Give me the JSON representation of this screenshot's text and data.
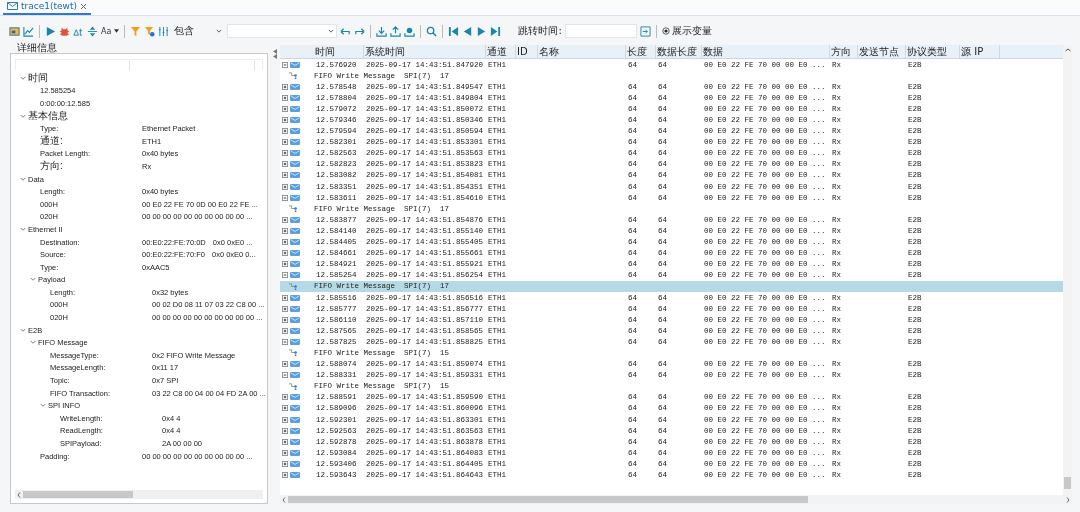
{
  "tab": {
    "label": "trace1(tewt)",
    "selected": true
  },
  "toolbar": {
    "font_label": "Aa",
    "filter_mode": "包含",
    "jump_label": "跳转时间:",
    "show_vars": {
      "label": "展示变量",
      "selected": true
    }
  },
  "detail": {
    "title": "详细信息",
    "tree": [
      {
        "label": "时间",
        "expanded": true,
        "children": [
          {
            "label": "12.585254"
          },
          {
            "label": "0:00:00:12.585"
          }
        ]
      },
      {
        "label": "基本信息",
        "expanded": true,
        "children": [
          {
            "label": "Type:",
            "value": "Ethernet Packet"
          },
          {
            "label": "通道:",
            "value": "ETH1"
          },
          {
            "label": "Packet Length:",
            "value": "0x40 bytes"
          },
          {
            "label": "方向:",
            "value": "Rx"
          }
        ]
      },
      {
        "label": "Data",
        "expanded": true,
        "children": [
          {
            "label": "Length:",
            "value": "0x40 bytes"
          },
          {
            "label": "000H",
            "value": "00 E0 22 FE 70 0D 00 E0 22 FE ..."
          },
          {
            "label": "020H",
            "value": "00 00 00 00 00 00 00 00 00 00 ..."
          }
        ]
      },
      {
        "label": "Ethernet II",
        "expanded": true,
        "children": [
          {
            "label": "Destination:",
            "value": "00:E0:22:FE:70:0D",
            "value2": "0x0 0xE0 ..."
          },
          {
            "label": "Source:",
            "value": "00:E0:22:FE:70:F0",
            "value2": "0x0 0xE0 0..."
          },
          {
            "label": "Type:",
            "value": "0xAAC5"
          },
          {
            "label": "Payload",
            "expanded": true,
            "children": [
              {
                "label": "Length:",
                "value": "0x32 bytes"
              },
              {
                "label": "000H",
                "value": "00 02 D0 08 11 07 03 22 C8 00 ..."
              },
              {
                "label": "020H",
                "value": "00 00 00 00 00 00 00 00 00 00 ..."
              }
            ]
          }
        ]
      },
      {
        "label": "E2B",
        "expanded": true,
        "children": [
          {
            "label": "FIFO Message",
            "expanded": true,
            "children": [
              {
                "label": "MessageType:",
                "value": "0x2 FIFO Write Message"
              },
              {
                "label": "MessageLength:",
                "value": "0x11 17"
              },
              {
                "label": "Topic:",
                "value": "0x7 SPI"
              },
              {
                "label": "FIFO Transaction:",
                "value": "03 22 C8 00 04 00 04 FD 2A 00 ..."
              },
              {
                "label": "SPI INFO",
                "expanded": true,
                "children": [
                  {
                    "label": "WriteLength:",
                    "value": "0x4 4"
                  },
                  {
                    "label": "ReadLength:",
                    "value": "0x4 4"
                  },
                  {
                    "label": "SPIPayload:",
                    "value": "2A 00 00 00"
                  }
                ]
              }
            ]
          },
          {
            "label": "Padding:",
            "value": "00 00 00 00 00 00 00 00 00 00 ..."
          }
        ]
      }
    ]
  },
  "table": {
    "columns": [
      "时间",
      "系统时间",
      "通道",
      "ID",
      "名称",
      "长度",
      "数据长度",
      "数据",
      "方向",
      "发送节点",
      "协议类型",
      "源 IP"
    ],
    "rows": [
      {
        "kind": "packet",
        "expanded": true,
        "selected": false,
        "time": "12.576920",
        "sys_time": "2025-09-17 14:43:51.847920",
        "channel": "ETH1",
        "length": "64",
        "data_length": "64",
        "data": "00 E0 22 FE 70 00 00 E0 ...",
        "direction": "Rx",
        "protocol": "E2B"
      },
      {
        "kind": "message",
        "selected": false,
        "text": "FIFO Write Message  SPI(7)  17"
      },
      {
        "kind": "packet",
        "expanded": false,
        "selected": false,
        "time": "12.578548",
        "sys_time": "2025-09-17 14:43:51.849547",
        "channel": "ETH1",
        "length": "64",
        "data_length": "64",
        "data": "00 E0 22 FE 70 00 00 E0 ...",
        "direction": "Rx",
        "protocol": "E2B"
      },
      {
        "kind": "packet",
        "expanded": false,
        "selected": false,
        "time": "12.578804",
        "sys_time": "2025-09-17 14:43:51.849804",
        "channel": "ETH1",
        "length": "64",
        "data_length": "64",
        "data": "00 E0 22 FE 70 00 00 E0 ...",
        "direction": "Rx",
        "protocol": "E2B"
      },
      {
        "kind": "packet",
        "expanded": false,
        "selected": false,
        "time": "12.579072",
        "sys_time": "2025-09-17 14:43:51.850072",
        "channel": "ETH1",
        "length": "64",
        "data_length": "64",
        "data": "00 E0 22 FE 70 00 00 E0 ...",
        "direction": "Rx",
        "protocol": "E2B"
      },
      {
        "kind": "packet",
        "expanded": false,
        "selected": false,
        "time": "12.579346",
        "sys_time": "2025-09-17 14:43:51.850346",
        "channel": "ETH1",
        "length": "64",
        "data_length": "64",
        "data": "00 E0 22 FE 70 00 00 E0 ...",
        "direction": "Rx",
        "protocol": "E2B"
      },
      {
        "kind": "packet",
        "expanded": false,
        "selected": false,
        "time": "12.579594",
        "sys_time": "2025-09-17 14:43:51.850594",
        "channel": "ETH1",
        "length": "64",
        "data_length": "64",
        "data": "00 E0 22 FE 70 00 00 E0 ...",
        "direction": "Rx",
        "protocol": "E2B"
      },
      {
        "kind": "packet",
        "expanded": false,
        "selected": false,
        "time": "12.582301",
        "sys_time": "2025-09-17 14:43:51.853301",
        "channel": "ETH1",
        "length": "64",
        "data_length": "64",
        "data": "00 E0 22 FE 70 00 00 E0 ...",
        "direction": "Rx",
        "protocol": "E2B"
      },
      {
        "kind": "packet",
        "expanded": false,
        "selected": false,
        "time": "12.582563",
        "sys_time": "2025-09-17 14:43:51.853563",
        "channel": "ETH1",
        "length": "64",
        "data_length": "64",
        "data": "00 E0 22 FE 70 00 00 E0 ...",
        "direction": "Rx",
        "protocol": "E2B"
      },
      {
        "kind": "packet",
        "expanded": false,
        "selected": false,
        "time": "12.582823",
        "sys_time": "2025-09-17 14:43:51.853823",
        "channel": "ETH1",
        "length": "64",
        "data_length": "64",
        "data": "00 E0 22 FE 70 00 00 E0 ...",
        "direction": "Rx",
        "protocol": "E2B"
      },
      {
        "kind": "packet",
        "expanded": false,
        "selected": false,
        "time": "12.583082",
        "sys_time": "2025-09-17 14:43:51.854081",
        "channel": "ETH1",
        "length": "64",
        "data_length": "64",
        "data": "00 E0 22 FE 70 00 00 E0 ...",
        "direction": "Rx",
        "protocol": "E2B"
      },
      {
        "kind": "packet",
        "expanded": false,
        "selected": false,
        "time": "12.583351",
        "sys_time": "2025-09-17 14:43:51.854351",
        "channel": "ETH1",
        "length": "64",
        "data_length": "64",
        "data": "00 E0 22 FE 70 00 00 E0 ...",
        "direction": "Rx",
        "protocol": "E2B"
      },
      {
        "kind": "packet",
        "expanded": true,
        "selected": false,
        "time": "12.583611",
        "sys_time": "2025-09-17 14:43:51.854610",
        "channel": "ETH1",
        "length": "64",
        "data_length": "64",
        "data": "00 E0 22 FE 70 00 00 E0 ...",
        "direction": "Rx",
        "protocol": "E2B"
      },
      {
        "kind": "message",
        "selected": false,
        "text": "FIFO Write Message  SPI(7)  17"
      },
      {
        "kind": "packet",
        "expanded": false,
        "selected": false,
        "time": "12.583877",
        "sys_time": "2025-09-17 14:43:51.854876",
        "channel": "ETH1",
        "length": "64",
        "data_length": "64",
        "data": "00 E0 22 FE 70 00 00 E0 ...",
        "direction": "Rx",
        "protocol": "E2B"
      },
      {
        "kind": "packet",
        "expanded": false,
        "selected": false,
        "time": "12.584140",
        "sys_time": "2025-09-17 14:43:51.855140",
        "channel": "ETH1",
        "length": "64",
        "data_length": "64",
        "data": "00 E0 22 FE 70 00 00 E0 ...",
        "direction": "Rx",
        "protocol": "E2B"
      },
      {
        "kind": "packet",
        "expanded": false,
        "selected": false,
        "time": "12.584405",
        "sys_time": "2025-09-17 14:43:51.855405",
        "channel": "ETH1",
        "length": "64",
        "data_length": "64",
        "data": "00 E0 22 FE 70 00 00 E0 ...",
        "direction": "Rx",
        "protocol": "E2B"
      },
      {
        "kind": "packet",
        "expanded": false,
        "selected": false,
        "time": "12.584661",
        "sys_time": "2025-09-17 14:43:51.855661",
        "channel": "ETH1",
        "length": "64",
        "data_length": "64",
        "data": "00 E0 22 FE 70 00 00 E0 ...",
        "direction": "Rx",
        "protocol": "E2B"
      },
      {
        "kind": "packet",
        "expanded": false,
        "selected": false,
        "time": "12.584921",
        "sys_time": "2025-09-17 14:43:51.855921",
        "channel": "ETH1",
        "length": "64",
        "data_length": "64",
        "data": "00 E0 22 FE 70 00 00 E0 ...",
        "direction": "Rx",
        "protocol": "E2B"
      },
      {
        "kind": "packet",
        "expanded": true,
        "selected": false,
        "time": "12.585254",
        "sys_time": "2025-09-17 14:43:51.856254",
        "channel": "ETH1",
        "length": "64",
        "data_length": "64",
        "data": "00 E0 22 FE 70 00 00 E0 ...",
        "direction": "Rx",
        "protocol": "E2B"
      },
      {
        "kind": "message",
        "selected": true,
        "text": "FIFO Write Message  SPI(7)  17"
      },
      {
        "kind": "packet",
        "expanded": false,
        "selected": false,
        "time": "12.585516",
        "sys_time": "2025-09-17 14:43:51.856516",
        "channel": "ETH1",
        "length": "64",
        "data_length": "64",
        "data": "00 E0 22 FE 70 00 00 E0 ...",
        "direction": "Rx",
        "protocol": "E2B"
      },
      {
        "kind": "packet",
        "expanded": false,
        "selected": false,
        "time": "12.585777",
        "sys_time": "2025-09-17 14:43:51.856777",
        "channel": "ETH1",
        "length": "64",
        "data_length": "64",
        "data": "00 E0 22 FE 70 00 00 E0 ...",
        "direction": "Rx",
        "protocol": "E2B"
      },
      {
        "kind": "packet",
        "expanded": false,
        "selected": false,
        "time": "12.586110",
        "sys_time": "2025-09-17 14:43:51.857110",
        "channel": "ETH1",
        "length": "64",
        "data_length": "64",
        "data": "00 E0 22 FE 70 00 00 E0 ...",
        "direction": "Rx",
        "protocol": "E2B"
      },
      {
        "kind": "packet",
        "expanded": false,
        "selected": false,
        "time": "12.587565",
        "sys_time": "2025-09-17 14:43:51.858565",
        "channel": "ETH1",
        "length": "64",
        "data_length": "64",
        "data": "00 E0 22 FE 70 00 00 E0 ...",
        "direction": "Rx",
        "protocol": "E2B"
      },
      {
        "kind": "packet",
        "expanded": true,
        "selected": false,
        "time": "12.587825",
        "sys_time": "2025-09-17 14:43:51.858825",
        "channel": "ETH1",
        "length": "64",
        "data_length": "64",
        "data": "00 E0 22 FE 70 00 00 E0 ...",
        "direction": "Rx",
        "protocol": "E2B"
      },
      {
        "kind": "message",
        "selected": false,
        "text": "FIFO Write Message  SPI(7)  15"
      },
      {
        "kind": "packet",
        "expanded": false,
        "selected": false,
        "time": "12.588074",
        "sys_time": "2025-09-17 14:43:51.859074",
        "channel": "ETH1",
        "length": "64",
        "data_length": "64",
        "data": "00 E0 22 FE 70 00 00 E0 ...",
        "direction": "Rx",
        "protocol": "E2B"
      },
      {
        "kind": "packet",
        "expanded": true,
        "selected": false,
        "time": "12.588331",
        "sys_time": "2025-09-17 14:43:51.859331",
        "channel": "ETH1",
        "length": "64",
        "data_length": "64",
        "data": "00 E0 22 FE 70 00 00 E0 ...",
        "direction": "Rx",
        "protocol": "E2B"
      },
      {
        "kind": "message",
        "selected": false,
        "text": "FIFO Write Message  SPI(7)  15"
      },
      {
        "kind": "packet",
        "expanded": false,
        "selected": false,
        "time": "12.588591",
        "sys_time": "2025-09-17 14:43:51.859590",
        "channel": "ETH1",
        "length": "64",
        "data_length": "64",
        "data": "00 E0 22 FE 70 00 00 E0 ...",
        "direction": "Rx",
        "protocol": "E2B"
      },
      {
        "kind": "packet",
        "expanded": false,
        "selected": false,
        "time": "12.589096",
        "sys_time": "2025-09-17 14:43:51.860096",
        "channel": "ETH1",
        "length": "64",
        "data_length": "64",
        "data": "00 E0 22 FE 70 00 00 E0 ...",
        "direction": "Rx",
        "protocol": "E2B"
      },
      {
        "kind": "packet",
        "expanded": false,
        "selected": false,
        "time": "12.592301",
        "sys_time": "2025-09-17 14:43:51.863301",
        "channel": "ETH1",
        "length": "64",
        "data_length": "64",
        "data": "00 E0 22 FE 70 00 00 E0 ...",
        "direction": "Rx",
        "protocol": "E2B"
      },
      {
        "kind": "packet",
        "expanded": false,
        "selected": false,
        "time": "12.592563",
        "sys_time": "2025-09-17 14:43:51.863563",
        "channel": "ETH1",
        "length": "64",
        "data_length": "64",
        "data": "00 E0 22 FE 70 00 00 E0 ...",
        "direction": "Rx",
        "protocol": "E2B"
      },
      {
        "kind": "packet",
        "expanded": false,
        "selected": false,
        "time": "12.592878",
        "sys_time": "2025-09-17 14:43:51.863878",
        "channel": "ETH1",
        "length": "64",
        "data_length": "64",
        "data": "00 E0 22 FE 70 00 00 E0 ...",
        "direction": "Rx",
        "protocol": "E2B"
      },
      {
        "kind": "packet",
        "expanded": false,
        "selected": false,
        "time": "12.593084",
        "sys_time": "2025-09-17 14:43:51.864083",
        "channel": "ETH1",
        "length": "64",
        "data_length": "64",
        "data": "00 E0 22 FE 70 00 00 E0 ...",
        "direction": "Rx",
        "protocol": "E2B"
      },
      {
        "kind": "packet",
        "expanded": false,
        "selected": false,
        "time": "12.593406",
        "sys_time": "2025-09-17 14:43:51.864405",
        "channel": "ETH1",
        "length": "64",
        "data_length": "64",
        "data": "00 E0 22 FE 70 00 00 E0 ...",
        "direction": "Rx",
        "protocol": "E2B"
      },
      {
        "kind": "packet",
        "expanded": false,
        "selected": false,
        "time": "12.593643",
        "sys_time": "2025-09-17 14:43:51.864643",
        "channel": "ETH1",
        "length": "64",
        "data_length": "64",
        "data": "00 E0 22 FE 70 00 00 E0 ...",
        "direction": "Rx",
        "protocol": "E2B"
      }
    ]
  }
}
